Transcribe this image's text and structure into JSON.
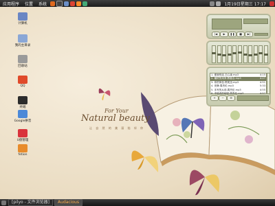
{
  "top_panel": {
    "menu_apps": "应用程序",
    "menu_places": "位置",
    "menu_system": "系统",
    "clock": "1月19日星期三 17:17"
  },
  "desktop_icons": [
    {
      "name": "desktop-icon-computer",
      "label": "计算机",
      "color": "#6a86c4"
    },
    {
      "name": "desktop-icon-home",
      "label": "我的主目录",
      "color": "#8aa7d6"
    },
    {
      "name": "desktop-icon-trash",
      "label": "回收站",
      "color": "#9a9a9a"
    },
    {
      "name": "desktop-icon-qq",
      "label": "QQ",
      "color": "#e04a2a"
    },
    {
      "name": "desktop-icon-shell",
      "label": "终端",
      "color": "#2c2c2c"
    },
    {
      "name": "desktop-icon-google",
      "label": "Google拼音",
      "color": "#4c89d8"
    },
    {
      "name": "desktop-icon-lunar",
      "label": "U盘管理",
      "color": "#d9333c"
    },
    {
      "name": "desktop-icon-fetion",
      "label": "fetion",
      "color": "#e88b2a"
    }
  ],
  "slogan": {
    "small": "For Your",
    "big": "Natural beauty",
    "sub": "让 自 然 的 美 丽 陪 伴 你"
  },
  "playlist": [
    {
      "title": "1. 爱我别走.王心凌.mp3",
      "time": "4:15"
    },
    {
      "title": "2. 最好的未来.群星合.mp3",
      "time": "4:27"
    },
    {
      "title": "3. 你的背包.陈奕迅.mp3",
      "time": "4:51"
    },
    {
      "title": "4. 安静.周杰伦.mp3",
      "time": "5:33"
    },
    {
      "title": "5. 手写的从前.周杰伦.mp3",
      "time": "4:55"
    },
    {
      "title": "6. 不能说的秘密.周杰伦.mp3",
      "time": "4:57"
    }
  ],
  "playlist_selected": 1,
  "player": {
    "eq_levels": [
      0.55,
      0.5,
      0.45,
      0.5,
      0.55,
      0.6,
      0.5,
      0.45,
      0.5,
      0.55,
      0.5
    ]
  },
  "bottom_panel": {
    "tasks": [
      {
        "label": "[pilyo - 文件浏览器]",
        "active": false
      },
      {
        "label": "Audacious",
        "active": true
      }
    ]
  }
}
